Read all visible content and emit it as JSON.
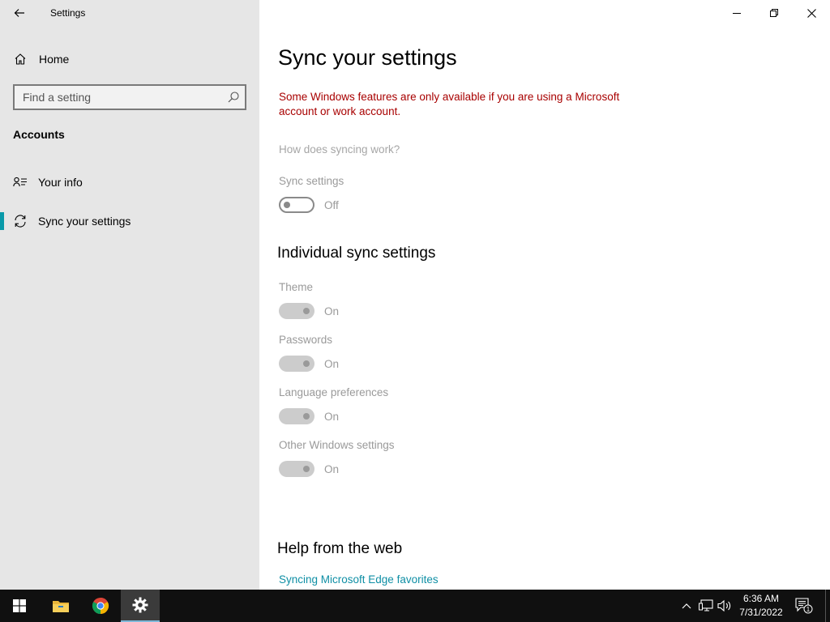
{
  "window": {
    "title": "Settings"
  },
  "sidebar": {
    "home_label": "Home",
    "search_placeholder": "Find a setting",
    "section_title": "Accounts",
    "items": [
      {
        "label": "Your info",
        "icon": "person-list-icon"
      },
      {
        "label": "Sync your settings",
        "icon": "sync-icon",
        "active": true
      }
    ]
  },
  "main": {
    "title": "Sync your settings",
    "warning": "Some Windows features are only available if you are using a Microsoft account or work account.",
    "how_link": "How does syncing work?",
    "sync_settings": {
      "label": "Sync settings",
      "state": "Off"
    },
    "individual_title": "Individual sync settings",
    "individual": [
      {
        "label": "Theme",
        "state": "On"
      },
      {
        "label": "Passwords",
        "state": "On"
      },
      {
        "label": "Language preferences",
        "state": "On"
      },
      {
        "label": "Other Windows settings",
        "state": "On"
      }
    ],
    "help_title": "Help from the web",
    "help_link": "Syncing Microsoft Edge favorites"
  },
  "taskbar": {
    "time": "6:36 AM",
    "date": "7/31/2022",
    "notification_count": "1"
  },
  "colors": {
    "accent": "#0a9aa9",
    "warning": "#a80000",
    "link": "#0f8fa5"
  }
}
